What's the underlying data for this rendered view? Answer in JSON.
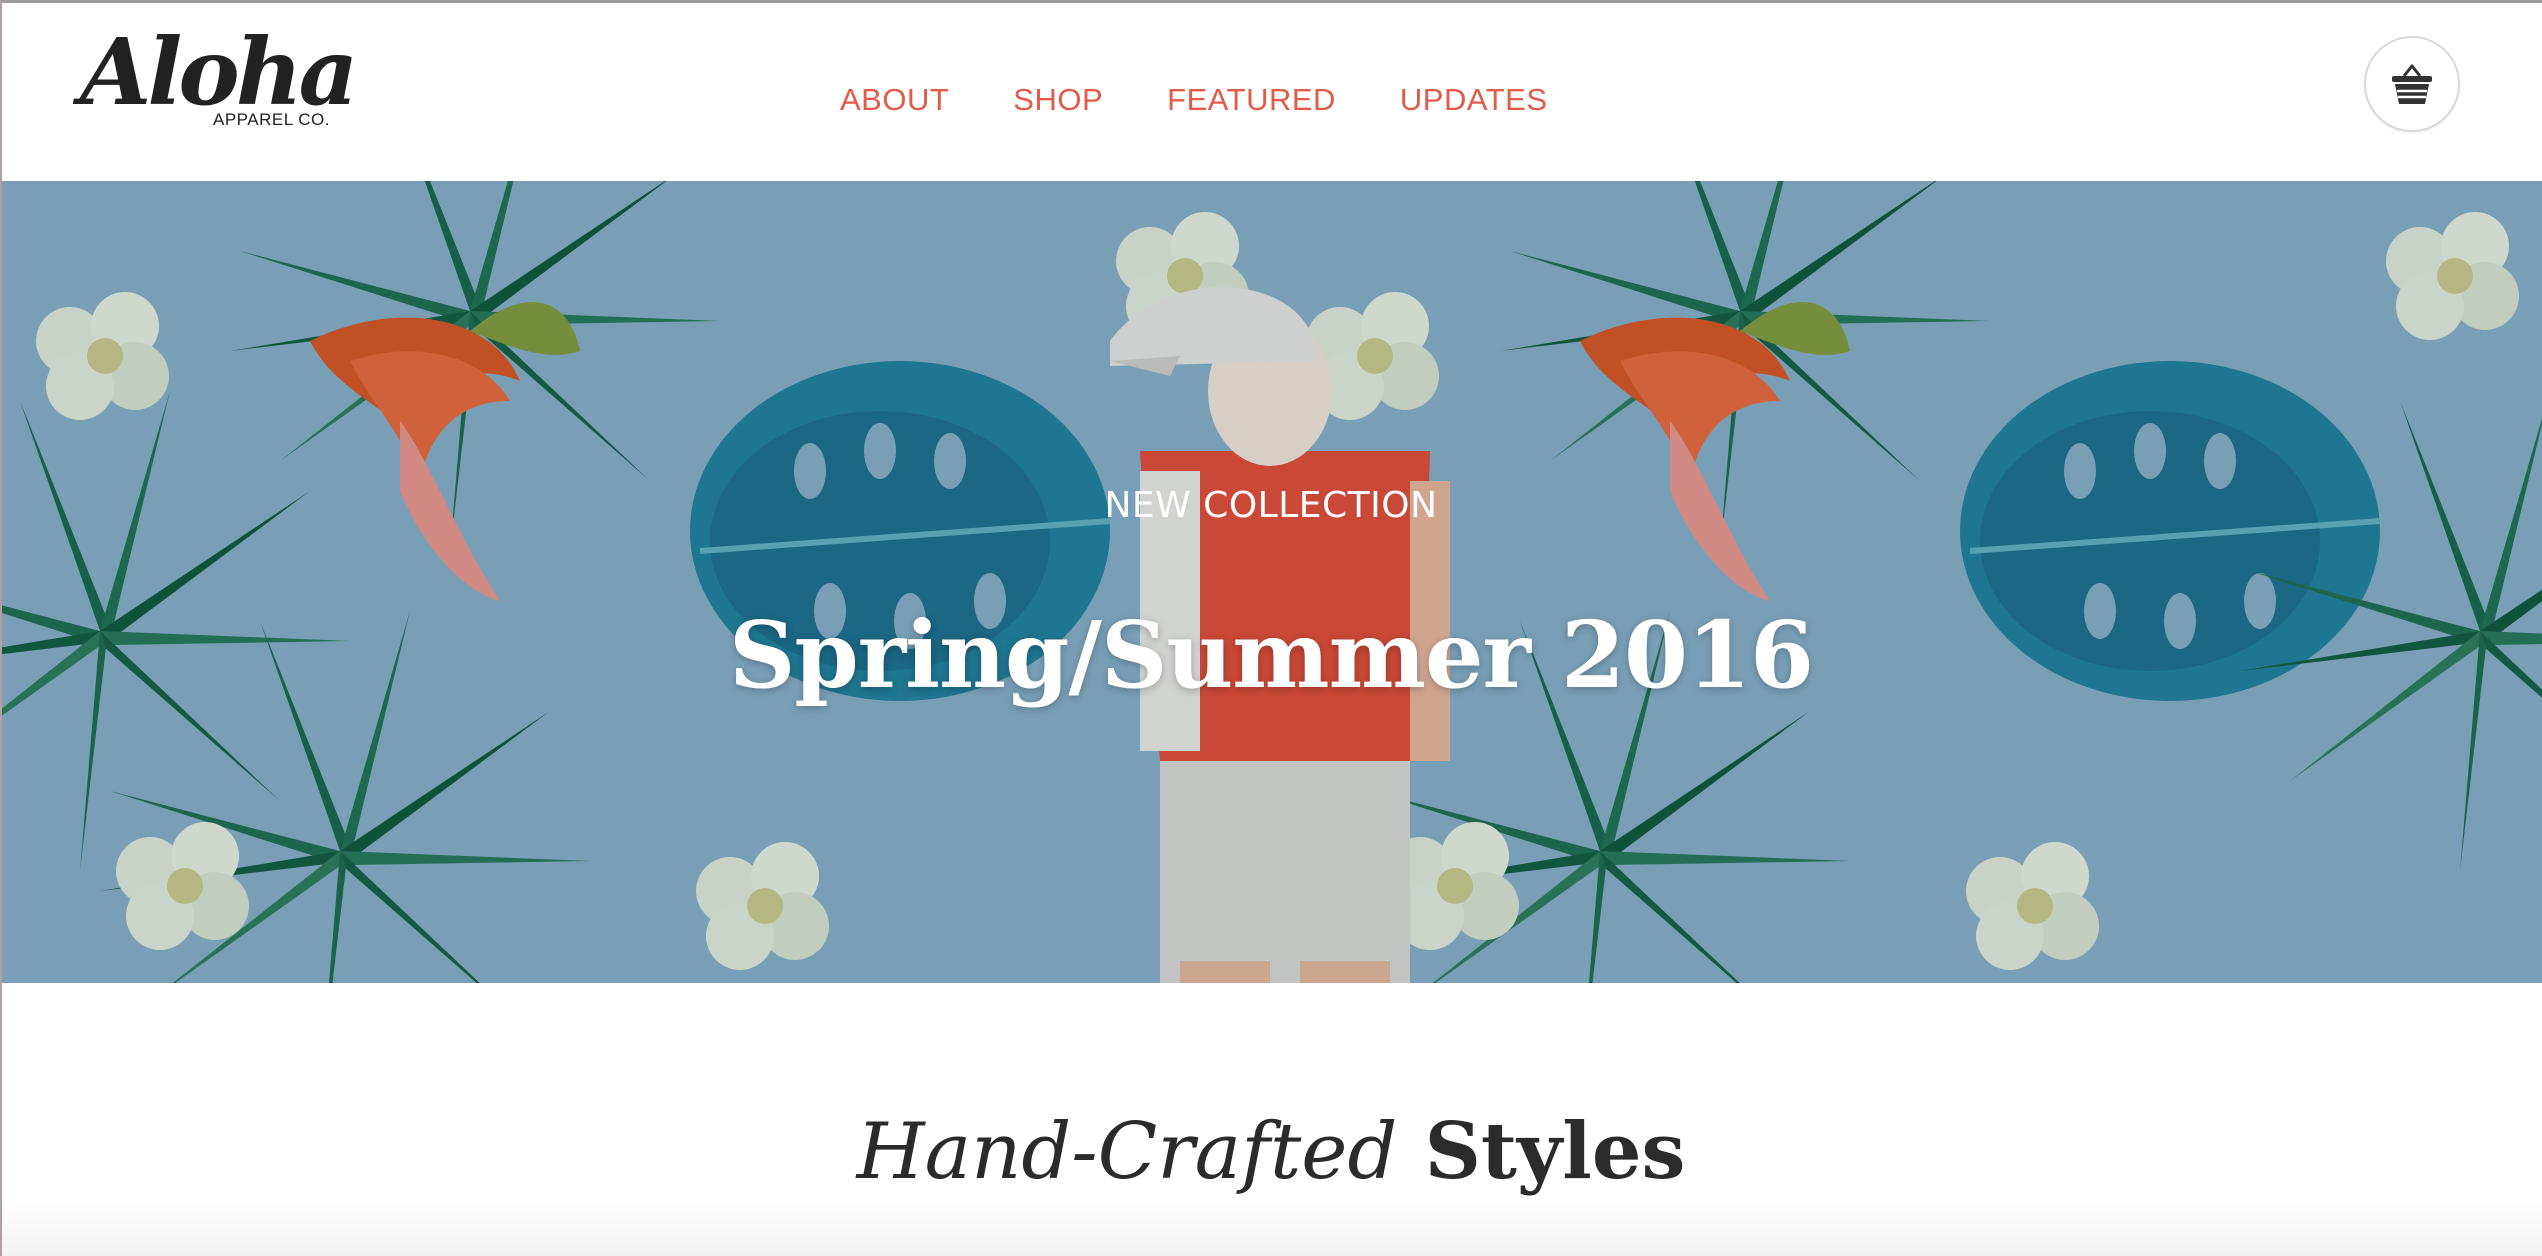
{
  "header": {
    "logo": {
      "word": "Aloha",
      "subtitle": "APPAREL CO."
    },
    "nav": [
      {
        "label": "ABOUT"
      },
      {
        "label": "SHOP"
      },
      {
        "label": "FEATURED"
      },
      {
        "label": "UPDATES"
      }
    ],
    "cart_icon": "basket-icon"
  },
  "hero": {
    "eyebrow": "NEW COLLECTION",
    "title": "Spring/Summer 2016"
  },
  "section": {
    "heading_italic": "Hand-Crafted",
    "heading_bold": "Styles"
  },
  "colors": {
    "accent": "#e25a48",
    "hero_background": "#85aec5",
    "text_dark": "#2b2b2b"
  }
}
